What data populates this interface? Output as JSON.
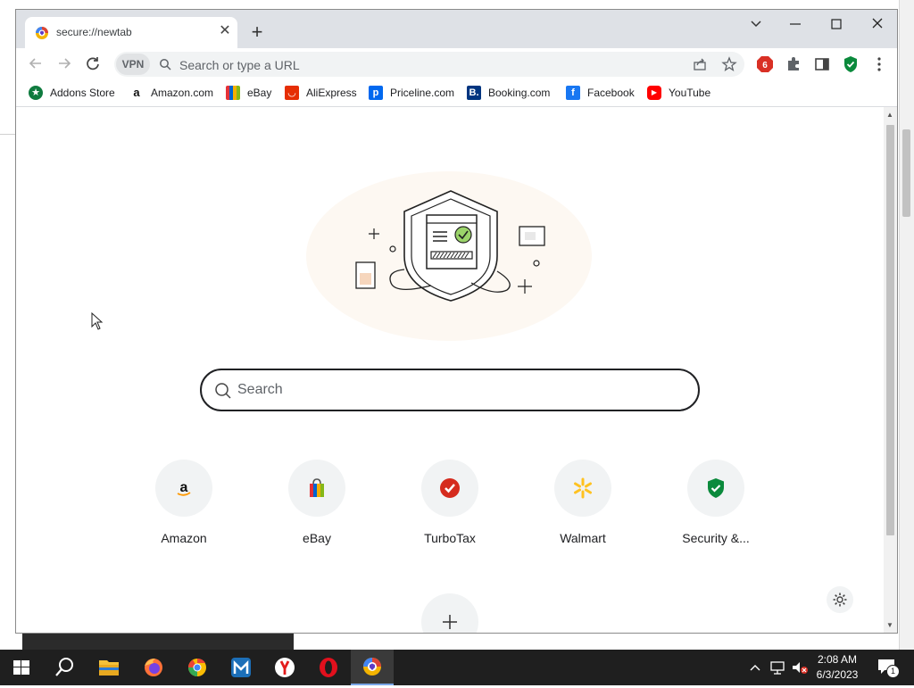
{
  "browser": {
    "tab": {
      "title": "secure://newtab"
    },
    "omnibox": {
      "vpn_label": "VPN",
      "placeholder": "Search or type a URL"
    }
  },
  "bookmarks": [
    {
      "label": "Addons Store",
      "icon": "addons-store-icon",
      "color": "#0f7b3f"
    },
    {
      "label": "Amazon.com",
      "icon": "amazon-icon",
      "color": "#111111"
    },
    {
      "label": "eBay",
      "icon": "ebay-icon",
      "color": "#e53238"
    },
    {
      "label": "AliExpress",
      "icon": "aliexpress-icon",
      "color": "#e62e04"
    },
    {
      "label": "Priceline.com",
      "icon": "priceline-icon",
      "color": "#0068ef"
    },
    {
      "label": "Booking.com",
      "icon": "booking-icon",
      "color": "#003580"
    },
    {
      "label": "Facebook",
      "icon": "facebook-icon",
      "color": "#1877f2"
    },
    {
      "label": "YouTube",
      "icon": "youtube-icon",
      "color": "#ff0000"
    }
  ],
  "newtab": {
    "search_placeholder": "Search",
    "shortcuts": [
      {
        "label": "Amazon",
        "icon": "amazon-icon"
      },
      {
        "label": "eBay",
        "icon": "ebay-bag-icon"
      },
      {
        "label": "TurboTax",
        "icon": "turbotax-icon"
      },
      {
        "label": "Walmart",
        "icon": "walmart-spark-icon"
      },
      {
        "label": "Security &...",
        "icon": "shield-check-icon"
      }
    ]
  },
  "taskbar": {
    "apps": [
      "start-icon",
      "search-icon",
      "file-explorer-icon",
      "firefox-icon",
      "chrome-icon",
      "maxthon-icon",
      "yandex-icon",
      "opera-icon",
      "secure-browser-icon"
    ],
    "clock": {
      "time": "2:08 AM",
      "date": "6/3/2023"
    },
    "notification_count": "1"
  },
  "colors": {
    "accent_green": "#0b8a3c",
    "red_badge": "#d93025",
    "taskbar": "#1f1f1f"
  }
}
